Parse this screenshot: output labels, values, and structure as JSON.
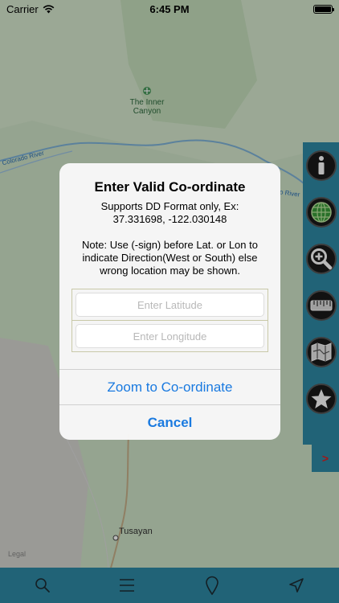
{
  "status_bar": {
    "carrier": "Carrier",
    "time": "6:45 PM",
    "battery_level": 1.0
  },
  "map": {
    "poi_label": "The Inner Canyon",
    "river_label_left": "Colorado River",
    "river_label_right": "o River",
    "town_label": "Tusayan",
    "legal_label": "Legal"
  },
  "side_toolbar": {
    "items": [
      {
        "icon": "info-icon"
      },
      {
        "icon": "globe-icon"
      },
      {
        "icon": "zoom-in-icon"
      },
      {
        "icon": "ruler-icon"
      },
      {
        "icon": "map-icon"
      },
      {
        "icon": "star-icon"
      }
    ],
    "expand_label": ">"
  },
  "bottom_bar": {
    "items": [
      {
        "icon": "search-icon"
      },
      {
        "icon": "menu-icon"
      },
      {
        "icon": "location-pin-icon"
      },
      {
        "icon": "navigation-arrow-icon"
      }
    ]
  },
  "alert": {
    "title": "Enter Valid Co-ordinate",
    "message_line1": "Supports DD Format only, Ex:",
    "message_line2": "37.331698, -122.030148",
    "note": "Note: Use (-sign) before Lat. or Lon to indicate Direction(West or South) else wrong location may be shown.",
    "latitude_placeholder": "Enter Latitude",
    "longitude_placeholder": "Enter Longitude",
    "zoom_button": "Zoom to Co-ordinate",
    "cancel_button": "Cancel"
  },
  "colors": {
    "toolbar": "#2e8aa6",
    "link_blue": "#1a7ae0",
    "map_green": "#cfe3c8"
  }
}
